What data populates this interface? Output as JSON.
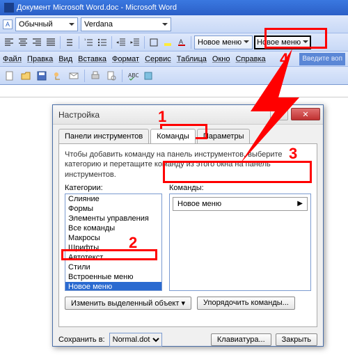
{
  "title": "Документ Microsoft Word.doc - Microsoft Word",
  "style_dropdown": "Обычный",
  "font_dropdown": "Verdana",
  "new_menu_label": "Новое меню",
  "menubar": {
    "file": "Файл",
    "edit": "Правка",
    "view": "Вид",
    "insert": "Вставка",
    "format": "Формат",
    "tools": "Сервис",
    "table": "Таблица",
    "window": "Окно",
    "help": "Справка"
  },
  "help_box": "Введите воп",
  "dialog": {
    "title": "Настройка",
    "tabs": {
      "toolbars": "Панели инструментов",
      "commands": "Команды",
      "options": "Параметры"
    },
    "instructions": "Чтобы добавить команду на панель инструментов, выберите категорию и перетащите команду из этого окна на панель инструментов.",
    "categories_label": "Категории:",
    "commands_label": "Команды:",
    "categories": [
      "Слияние",
      "Формы",
      "Элементы управления",
      "Все команды",
      "Макросы",
      "Шрифты",
      "Автотекст",
      "Стили",
      "Встроенные меню",
      "Новое меню"
    ],
    "selected_category_index": 9,
    "command_item": "Новое меню",
    "modify_btn": "Изменить выделенный объект",
    "rearrange_btn": "Упорядочить команды...",
    "save_in_label": "Сохранить в:",
    "save_in_value": "Normal.dot",
    "keyboard_btn": "Клавиатура...",
    "close_btn": "Закрыть"
  },
  "annotations": {
    "n1": "1",
    "n2": "2",
    "n3": "3",
    "n4": "4"
  }
}
